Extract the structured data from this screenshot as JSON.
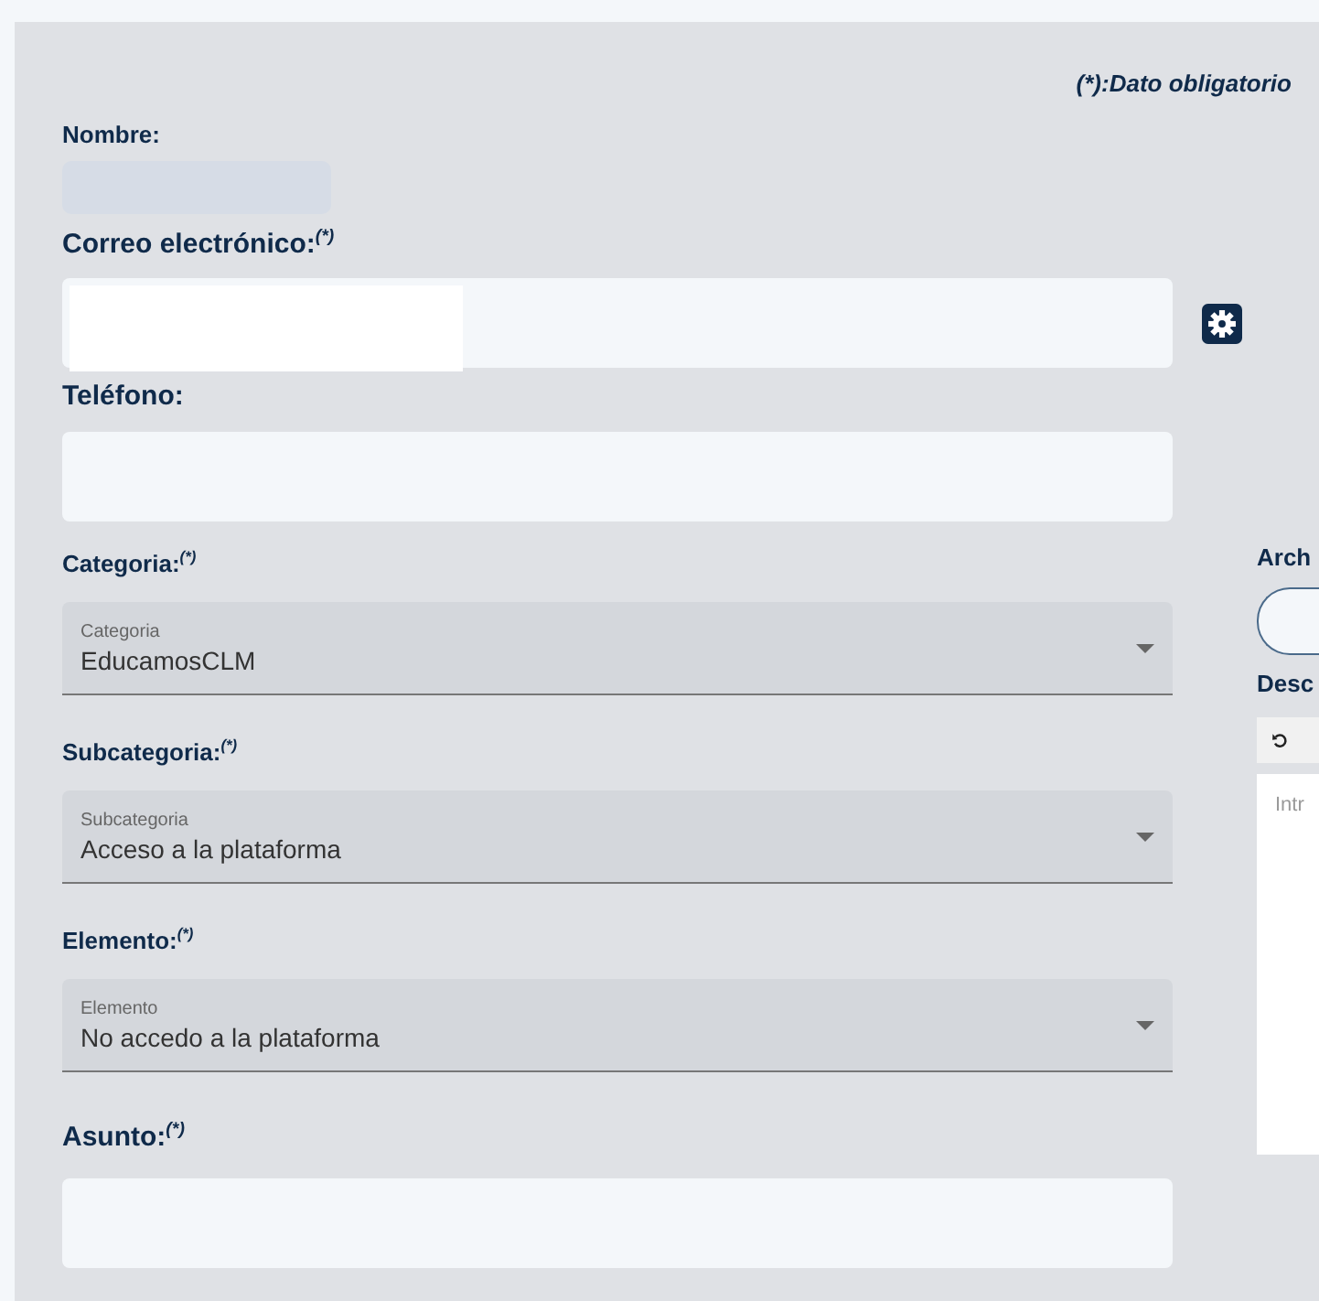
{
  "required_note": "(*):Dato obligatorio",
  "top_fields": [
    {
      "label": "Nombre:",
      "kind": "readonly"
    },
    {
      "label": "Correo electrónico:$^{(*)}$",
      "kind": "input",
      "redacted": true,
      "settings": true
    },
    {
      "label": "Teléfono:",
      "kind": "input"
    }
  ],
  "selects": [
    {
      "label": "Categoria:$^{(*)}$",
      "floating_label": "Categoria",
      "value": "EducamosCLM"
    },
    {
      "label": "Subcategoria:$^{(*)}$",
      "floating_label": "Subcategoria",
      "value": "Acceso a la plataforma"
    },
    {
      "label": "Elemento:$^{(*)}$",
      "floating_label": "Elemento",
      "value": "No accedo a la plataforma"
    }
  ],
  "subject": {
    "label": "Asunto:$^{(*)}$"
  },
  "side_panel": {
    "attachments_label": "Arch",
    "description_label": "Desc",
    "editor_placeholder": "Intr"
  }
}
